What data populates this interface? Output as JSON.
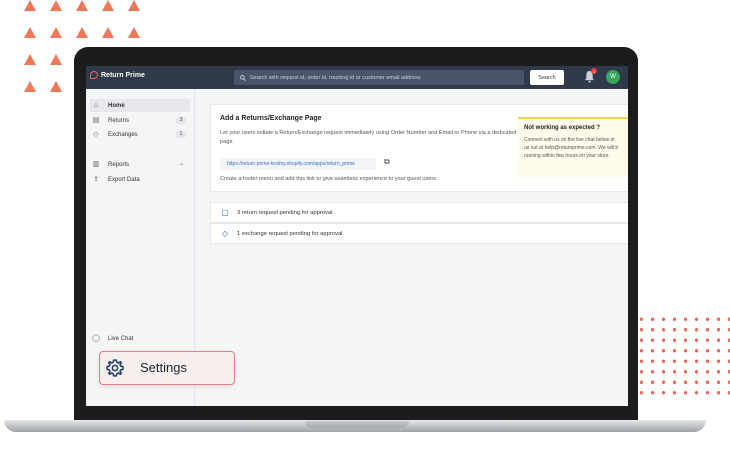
{
  "app": {
    "title": "Return Prime",
    "search_placeholder": "Search with request id, order id, tracking id or customer email address",
    "search_button": "Search",
    "notification_count": "1",
    "avatar_initial": "W"
  },
  "sidebar": {
    "items": [
      {
        "label": "Home",
        "icon": "home-icon",
        "active": true
      },
      {
        "label": "Returns",
        "icon": "returns-icon",
        "count": "3"
      },
      {
        "label": "Exchanges",
        "icon": "tag-icon",
        "count": "1"
      },
      {
        "label": "Reports",
        "icon": "chart-icon"
      },
      {
        "label": "Export Data",
        "icon": "export-icon"
      }
    ],
    "live_chat": "Live Chat"
  },
  "main": {
    "card": {
      "title": "Add a Returns/Exchange Page",
      "description": "Let your users initiate a Return/Exchange request immediately using Order Number and Email or Phone via a dedicated page.",
      "url": "https://return-prime-testmy.shopify.com/apps/return_prime",
      "footer_text": "Create a footer menu and add this link to give seamless experience to your guest users."
    },
    "notice": {
      "title": "Not working as expected ?",
      "line1": "Connect with us on the live chat below or",
      "line2": "us out at help@returnprime.com. We will b",
      "line3": "running within few hours on your store."
    },
    "pending": [
      {
        "text": "3 return request pending for approval",
        "icon": "clipboard-icon"
      },
      {
        "text": "1 exchange request pending for approval",
        "icon": "tag-icon"
      }
    ]
  },
  "popover": {
    "label": "Settings",
    "icon": "gear-icon"
  },
  "colors": {
    "accent": "#f0775a",
    "topbar": "#2e3a4a",
    "popover_border": "#e97c7c"
  }
}
